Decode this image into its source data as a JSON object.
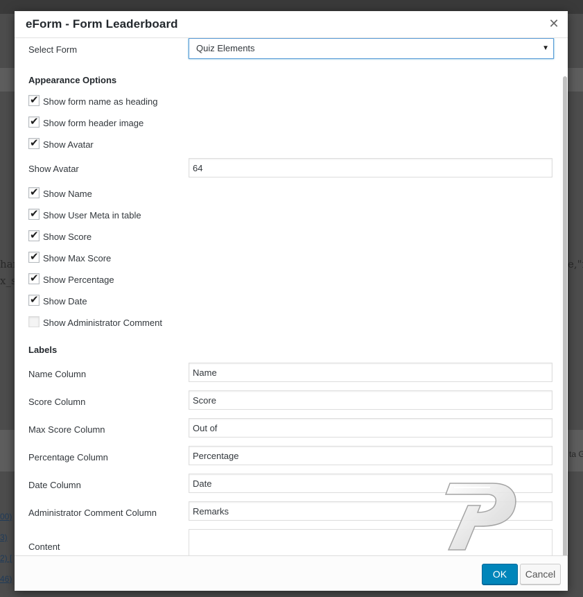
{
  "dialog": {
    "title": "eForm - Form Leaderboard",
    "close_icon": "close-icon"
  },
  "select_form": {
    "label": "Select Form",
    "value": "Quiz Elements"
  },
  "appearance": {
    "title": "Appearance Options",
    "checks": [
      {
        "label": "Show form name as heading",
        "checked": true
      },
      {
        "label": "Show form header image",
        "checked": true
      },
      {
        "label": "Show Avatar",
        "checked": true
      }
    ],
    "avatar_size": {
      "label": "Show Avatar",
      "value": "64"
    },
    "checks2": [
      {
        "label": "Show Name",
        "checked": true
      },
      {
        "label": "Show User Meta in table",
        "checked": true
      },
      {
        "label": "Show Score",
        "checked": true
      },
      {
        "label": "Show Max Score",
        "checked": true
      },
      {
        "label": "Show Percentage",
        "checked": true
      },
      {
        "label": "Show Date",
        "checked": true
      },
      {
        "label": "Show Administrator Comment",
        "checked": false
      }
    ]
  },
  "labels": {
    "title": "Labels",
    "fields": [
      {
        "label": "Name Column",
        "value": "Name"
      },
      {
        "label": "Score Column",
        "value": "Score"
      },
      {
        "label": "Max Score Column",
        "value": "Out of"
      },
      {
        "label": "Percentage Column",
        "value": "Percentage"
      },
      {
        "label": "Date Column",
        "value": "Date"
      },
      {
        "label": "Administrator Comment Column",
        "value": "Remarks"
      }
    ],
    "content_label": "Content"
  },
  "footer": {
    "ok_label": "OK",
    "cancel_label": "Cancel"
  },
  "background": {
    "text1": "han",
    "text2": "x_s",
    "text3": "e,\"r",
    "text4": "ta G",
    "links": [
      "00)",
      "3)",
      "2) [",
      "46)"
    ]
  }
}
